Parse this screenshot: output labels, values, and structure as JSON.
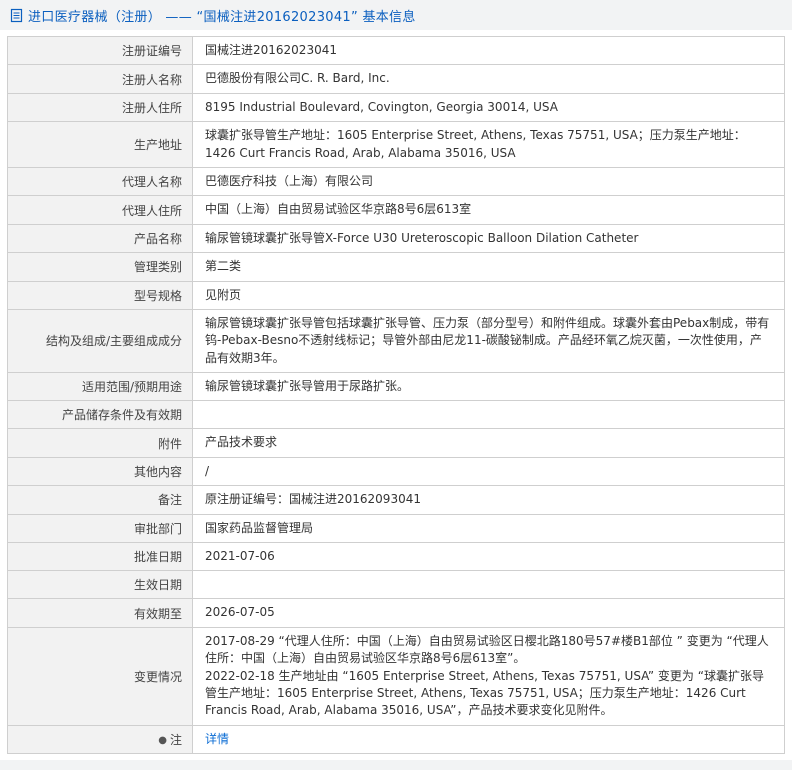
{
  "header": {
    "title": "进口医疗器械（注册） —— “国械注进20162023041” 基本信息"
  },
  "colors": {
    "title_blue": "#0b5fbf",
    "link_blue": "#0b6cd4",
    "label_bg": "#f2f2f2",
    "header_bg": "#f2f3f4",
    "border": "#cfcfcf"
  },
  "icons": {
    "document-icon": "document",
    "note-icon": "●"
  },
  "table": {
    "rows": [
      {
        "label": "注册证编号",
        "value": "国械注进20162023041"
      },
      {
        "label": "注册人名称",
        "value": "巴德股份有限公司C. R. Bard, Inc."
      },
      {
        "label": "注册人住所",
        "value": "8195 Industrial Boulevard, Covington, Georgia 30014, USA"
      },
      {
        "label": "生产地址",
        "value": "球囊扩张导管生产地址：1605 Enterprise Street, Athens, Texas 75751, USA；压力泵生产地址：1426 Curt Francis Road, Arab, Alabama 35016, USA"
      },
      {
        "label": "代理人名称",
        "value": "巴德医疗科技（上海）有限公司"
      },
      {
        "label": "代理人住所",
        "value": "中国（上海）自由贸易试验区华京路8号6层613室"
      },
      {
        "label": "产品名称",
        "value": "输尿管镜球囊扩张导管X-Force U30 Ureteroscopic Balloon Dilation Catheter"
      },
      {
        "label": "管理类别",
        "value": "第二类"
      },
      {
        "label": "型号规格",
        "value": "见附页"
      },
      {
        "label": "结构及组成/主要组成成分",
        "value": "输尿管镜球囊扩张导管包括球囊扩张导管、压力泵（部分型号）和附件组成。球囊外套由Pebax制成，带有钨-Pebax-Besno不透射线标记；导管外部由尼龙11-碳酸铋制成。产品经环氧乙烷灭菌，一次性使用，产品有效期3年。"
      },
      {
        "label": "适用范围/预期用途",
        "value": "输尿管镜球囊扩张导管用于尿路扩张。"
      },
      {
        "label": "产品储存条件及有效期",
        "value": ""
      },
      {
        "label": "附件",
        "value": "产品技术要求"
      },
      {
        "label": "其他内容",
        "value": "/"
      },
      {
        "label": "备注",
        "value": "原注册证编号：国械注进20162093041"
      },
      {
        "label": "审批部门",
        "value": "国家药品监督管理局"
      },
      {
        "label": "批准日期",
        "value": "2021-07-06"
      },
      {
        "label": "生效日期",
        "value": ""
      },
      {
        "label": "有效期至",
        "value": "2026-07-05"
      },
      {
        "label": "变更情况",
        "value": "2017-08-29 “代理人住所：中国（上海）自由贸易试验区日樱北路180号57#楼B1部位 ” 变更为 “代理人住所：中国（上海）自由贸易试验区华京路8号6层613室”。\n2022-02-18 生产地址由 “1605 Enterprise Street, Athens, Texas 75751, USA” 变更为 “球囊扩张导管生产地址：1605 Enterprise Street, Athens, Texas 75751, USA；压力泵生产地址：1426 Curt Francis Road, Arab, Alabama 35016, USA”，产品技术要求变化见附件。"
      },
      {
        "label": "注",
        "icon": "note-icon",
        "value": "详情",
        "link": true
      }
    ]
  }
}
